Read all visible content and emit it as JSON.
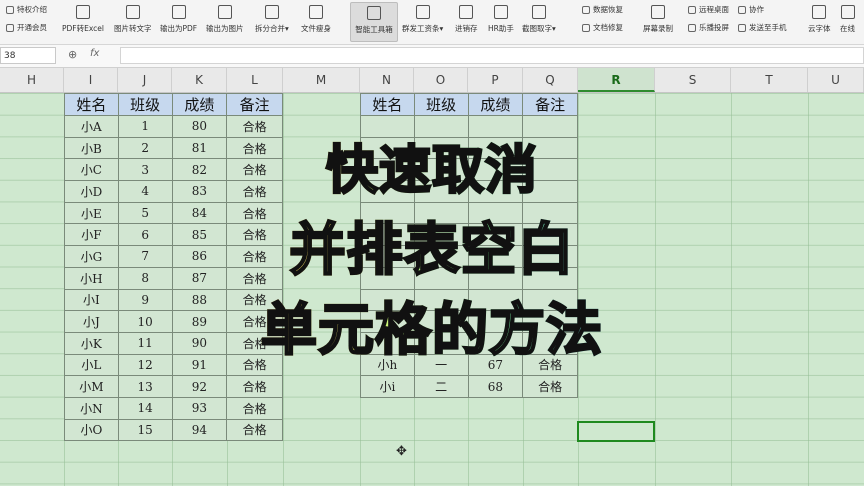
{
  "ribbon": {
    "left_top": "特权介绍",
    "left_bottom": "开通会员",
    "tools": [
      "PDF转Excel",
      "图片转文字",
      "输出为PDF",
      "输出为图片",
      "拆分合并",
      "文件瘦身",
      "智能工具箱",
      "群发工资条",
      "进销存",
      "HR助手",
      "截图取字"
    ],
    "right_small": [
      "数据恢复",
      "文档修复",
      "屏幕录制",
      "远程桌面",
      "乐播投屏",
      "协作",
      "发送至手机",
      "云字体",
      "在线"
    ],
    "dropdown_mark": "▾"
  },
  "formula_bar": {
    "name_box": "38",
    "zoom_icon": "⊕",
    "fx_label": "fx",
    "value": ""
  },
  "columns": [
    "H",
    "I",
    "J",
    "K",
    "L",
    "M",
    "N",
    "O",
    "P",
    "Q",
    "R",
    "S",
    "T",
    "U"
  ],
  "selected_column": "R",
  "left_table": {
    "headers": [
      "姓名",
      "班级",
      "成绩",
      "备注"
    ],
    "rows": [
      [
        "小A",
        "1",
        "80",
        "合格"
      ],
      [
        "小B",
        "2",
        "81",
        "合格"
      ],
      [
        "小C",
        "3",
        "82",
        "合格"
      ],
      [
        "小D",
        "4",
        "83",
        "合格"
      ],
      [
        "小E",
        "5",
        "84",
        "合格"
      ],
      [
        "小F",
        "6",
        "85",
        "合格"
      ],
      [
        "小G",
        "7",
        "86",
        "合格"
      ],
      [
        "小H",
        "8",
        "87",
        "合格"
      ],
      [
        "小I",
        "9",
        "88",
        "合格"
      ],
      [
        "小J",
        "10",
        "89",
        "合格"
      ],
      [
        "小K",
        "11",
        "90",
        "合格"
      ],
      [
        "小L",
        "12",
        "91",
        "合格"
      ],
      [
        "小M",
        "13",
        "92",
        "合格"
      ],
      [
        "小N",
        "14",
        "93",
        "合格"
      ],
      [
        "小O",
        "15",
        "94",
        "合格"
      ]
    ]
  },
  "right_table": {
    "headers": [
      "姓名",
      "班级",
      "成绩",
      "备注"
    ],
    "rows": [
      [
        "",
        "",
        "",
        ""
      ],
      [
        "",
        "",
        "",
        ""
      ],
      [
        "",
        "",
        "",
        ""
      ],
      [
        "",
        "",
        "",
        ""
      ],
      [
        "",
        "",
        "",
        ""
      ],
      [
        "",
        "",
        "",
        ""
      ],
      [
        "",
        "",
        "",
        ""
      ],
      [
        "",
        "",
        "",
        ""
      ],
      [
        "",
        "",
        "",
        ""
      ],
      [
        "",
        "",
        "",
        ""
      ],
      [
        "",
        "",
        "",
        ""
      ],
      [
        "小h",
        "一",
        "67",
        "合格"
      ],
      [
        "小i",
        "二",
        "68",
        "合格"
      ]
    ]
  },
  "overlay_title": [
    "快速取消",
    "并排表空白",
    "单元格的方法"
  ],
  "cursor_glyph": "✥"
}
